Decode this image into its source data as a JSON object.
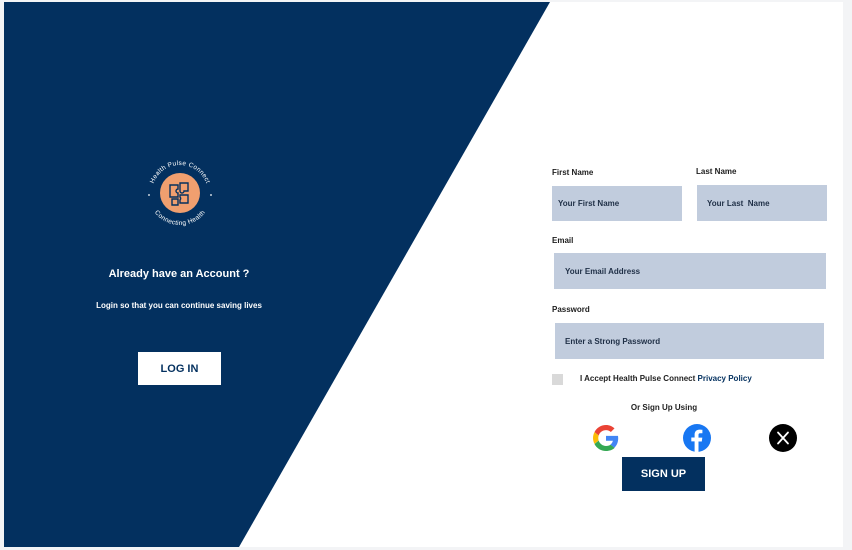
{
  "colors": {
    "navy": "#03305f",
    "field_bg": "#c1ccdd",
    "logo_orange": "#f09f6f"
  },
  "logo": {
    "ring_text_top": "Health Pulse Connect",
    "ring_text_bottom": "Connecting Health"
  },
  "left_panel": {
    "heading": "Already have an Account ?",
    "subtext": "Login so that you can continue saving lives",
    "login_label": "LOG IN"
  },
  "form": {
    "first_name": {
      "label": "First Name",
      "placeholder": "Your First Name"
    },
    "last_name": {
      "label": "Last Name",
      "placeholder": "Your Last  Name"
    },
    "email": {
      "label": "Email",
      "placeholder": "Your Email Address"
    },
    "password": {
      "label": "Password",
      "placeholder": "Enter a Strong Password"
    },
    "accept_text": "I Accept Health Pulse Connect",
    "privacy_link": "Privacy Policy",
    "or_text": "Or Sign Up Using",
    "social": [
      "google-icon",
      "facebook-icon",
      "x-icon"
    ],
    "signup_label": "SIGN UP"
  }
}
